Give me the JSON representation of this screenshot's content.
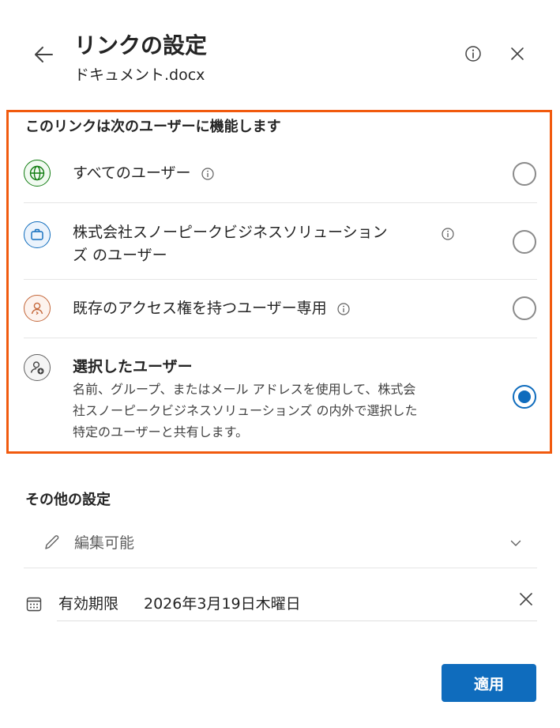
{
  "header": {
    "title": "リンクの設定",
    "subtitle": "ドキュメント.docx"
  },
  "audience": {
    "section_title": "このリンクは次のユーザーに機能します",
    "options": [
      {
        "label": "すべてのユーザー",
        "icon": "globe-icon",
        "has_info": true,
        "selected": false
      },
      {
        "label": "株式会社スノーピークビジネスソリューション",
        "label_line2": "ズ のユーザー",
        "icon": "briefcase-icon",
        "has_info": true,
        "selected": false
      },
      {
        "label": "既存のアクセス権を持つユーザー専用",
        "icon": "person-icon",
        "has_info": true,
        "selected": false
      },
      {
        "label": "選択したユーザー",
        "icon": "person-add-icon",
        "has_info": false,
        "selected": true,
        "description_lines": [
          "名前、グループ、またはメール アドレスを使用して、株式会",
          "社スノーピークビジネスソリューションズ の内外で選択した",
          "特定のユーザーと共有します。"
        ]
      }
    ]
  },
  "other_settings": {
    "title": "その他の設定",
    "permission": "編集可能",
    "expiration_label": "有効期限",
    "expiration_date": "2026年3月19日木曜日"
  },
  "footer": {
    "apply_label": "適用"
  },
  "colors": {
    "accent": "#0f6cbd",
    "highlight_border": "#f15a0e",
    "globe": "#107c10",
    "briefcase": "#0f6cbd",
    "person": "#c4673a"
  }
}
